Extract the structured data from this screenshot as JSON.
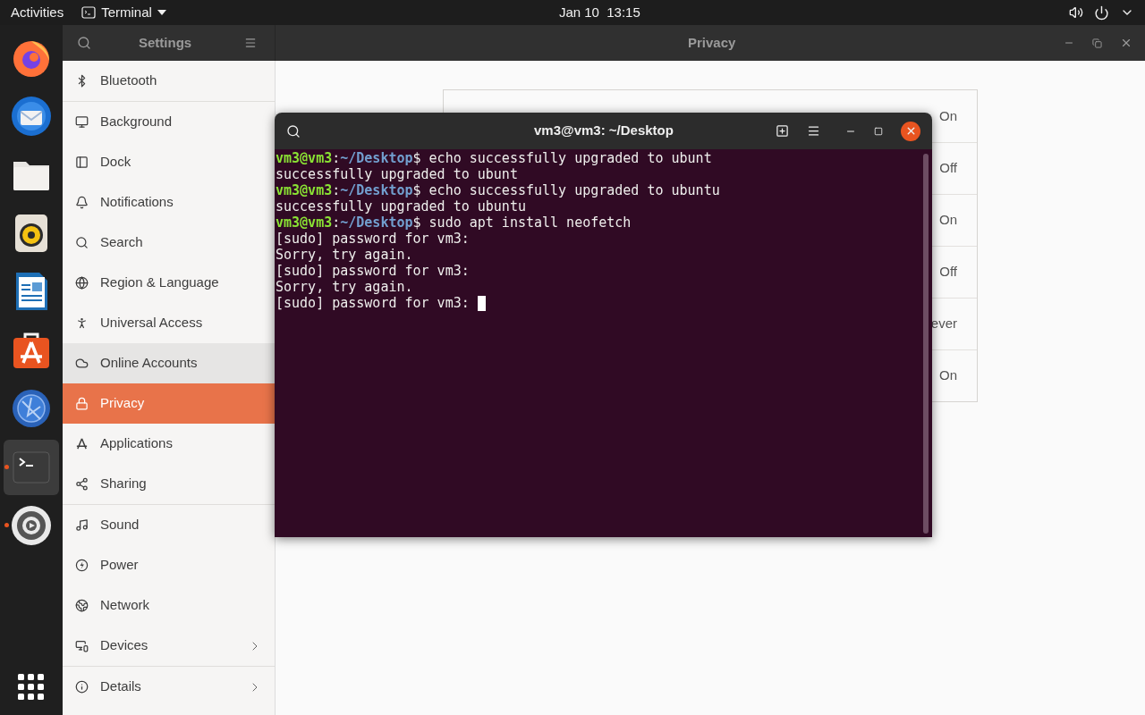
{
  "top_bar": {
    "activities": "Activities",
    "app_menu": "Terminal",
    "clock": "Jan 10  13:15"
  },
  "dock": [
    {
      "running": false,
      "selected": false
    },
    {
      "running": false,
      "selected": false
    },
    {
      "running": false,
      "selected": false
    },
    {
      "running": false,
      "selected": false
    },
    {
      "running": false,
      "selected": false
    },
    {
      "running": false,
      "selected": false
    },
    {
      "running": false,
      "selected": false
    },
    {
      "running": true,
      "selected": true
    },
    {
      "running": true,
      "selected": false
    }
  ],
  "settings": {
    "sidebar_title": "Settings",
    "page_title": "Privacy",
    "sidebar_sections": [
      [
        {
          "label": "Bluetooth",
          "selected": false,
          "hovered": false,
          "has_arrow": false
        }
      ],
      [
        {
          "label": "Background",
          "selected": false,
          "hovered": false,
          "has_arrow": false
        },
        {
          "label": "Dock",
          "selected": false,
          "hovered": false,
          "has_arrow": false
        },
        {
          "label": "Notifications",
          "selected": false,
          "hovered": false,
          "has_arrow": false
        },
        {
          "label": "Search",
          "selected": false,
          "hovered": false,
          "has_arrow": false
        },
        {
          "label": "Region & Language",
          "selected": false,
          "hovered": false,
          "has_arrow": false
        },
        {
          "label": "Universal Access",
          "selected": false,
          "hovered": false,
          "has_arrow": false
        },
        {
          "label": "Online Accounts",
          "selected": false,
          "hovered": true,
          "has_arrow": false
        },
        {
          "label": "Privacy",
          "selected": true,
          "hovered": false,
          "has_arrow": false
        },
        {
          "label": "Applications",
          "selected": false,
          "hovered": false,
          "has_arrow": false
        },
        {
          "label": "Sharing",
          "selected": false,
          "hovered": false,
          "has_arrow": false
        }
      ],
      [
        {
          "label": "Sound",
          "selected": false,
          "hovered": false,
          "has_arrow": false
        },
        {
          "label": "Power",
          "selected": false,
          "hovered": false,
          "has_arrow": false
        },
        {
          "label": "Network",
          "selected": false,
          "hovered": false,
          "has_arrow": false
        },
        {
          "label": "Devices",
          "selected": false,
          "hovered": false,
          "has_arrow": true
        }
      ],
      [
        {
          "label": "Details",
          "selected": false,
          "hovered": false,
          "has_arrow": true
        }
      ]
    ],
    "privacy_rows": [
      {
        "value": "On"
      },
      {
        "value": "Off"
      },
      {
        "value": "On"
      },
      {
        "value": "Off"
      },
      {
        "value": "ever"
      },
      {
        "value": "On"
      }
    ]
  },
  "terminal": {
    "title": "vm3@vm3: ~/Desktop",
    "lines": [
      {
        "kind": "prompt",
        "user": "vm3@vm3",
        "sep": ":",
        "path": "~/Desktop",
        "command": "$ echo successfully upgraded to ubunt"
      },
      {
        "kind": "output",
        "text": "successfully upgraded to ubunt"
      },
      {
        "kind": "prompt",
        "user": "vm3@vm3",
        "sep": ":",
        "path": "~/Desktop",
        "command": "$ echo successfully upgraded to ubuntu"
      },
      {
        "kind": "output",
        "text": "successfully upgraded to ubuntu"
      },
      {
        "kind": "prompt",
        "user": "vm3@vm3",
        "sep": ":",
        "path": "~/Desktop",
        "command": "$ sudo apt install neofetch"
      },
      {
        "kind": "output",
        "text": "[sudo] password for vm3:"
      },
      {
        "kind": "output",
        "text": "Sorry, try again."
      },
      {
        "kind": "output",
        "text": "[sudo] password for vm3:"
      },
      {
        "kind": "output",
        "text": "Sorry, try again."
      },
      {
        "kind": "output",
        "text": "[sudo] password for vm3:",
        "cursor": true
      }
    ]
  }
}
